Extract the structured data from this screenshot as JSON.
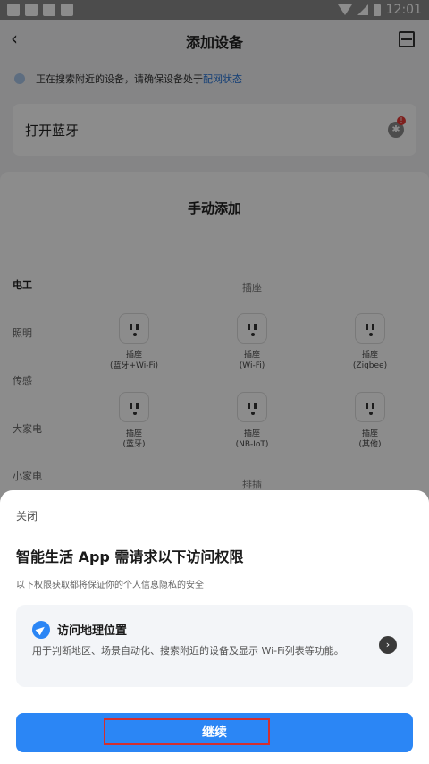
{
  "status_bar": {
    "time": "12:01"
  },
  "header": {
    "title": "添加设备"
  },
  "search_hint": {
    "text": "正在搜索附近的设备，请确保设备处于",
    "link": "配网状态"
  },
  "bluetooth_card": {
    "label": "打开蓝牙",
    "badge": "!"
  },
  "manual_add": {
    "title": "手动添加",
    "categories": [
      "电工",
      "照明",
      "传感",
      "大家电",
      "小家电"
    ],
    "groups": [
      "插座",
      "排插"
    ],
    "devices": [
      {
        "name": "插座\n(蓝牙+Wi-Fi)"
      },
      {
        "name": "插座\n(Wi-Fi)"
      },
      {
        "name": "插座\n(Zigbee)"
      },
      {
        "name": "插座\n(蓝牙)"
      },
      {
        "name": "插座\n(NB-IoT)"
      },
      {
        "name": "插座\n(其他)"
      }
    ]
  },
  "sheet": {
    "close": "关闭",
    "title": "智能生活 App 需请求以下访问权限",
    "subtitle": "以下权限获取都将保证你的个人信息隐私的安全",
    "permission": {
      "title": "访问地理位置",
      "description": "用于判断地区、场景自动化、搜索附近的设备及显示 Wi-Fi列表等功能。"
    },
    "continue": "继续"
  },
  "colors": {
    "accent": "#2b86f5",
    "highlight": "#d32f2f"
  }
}
